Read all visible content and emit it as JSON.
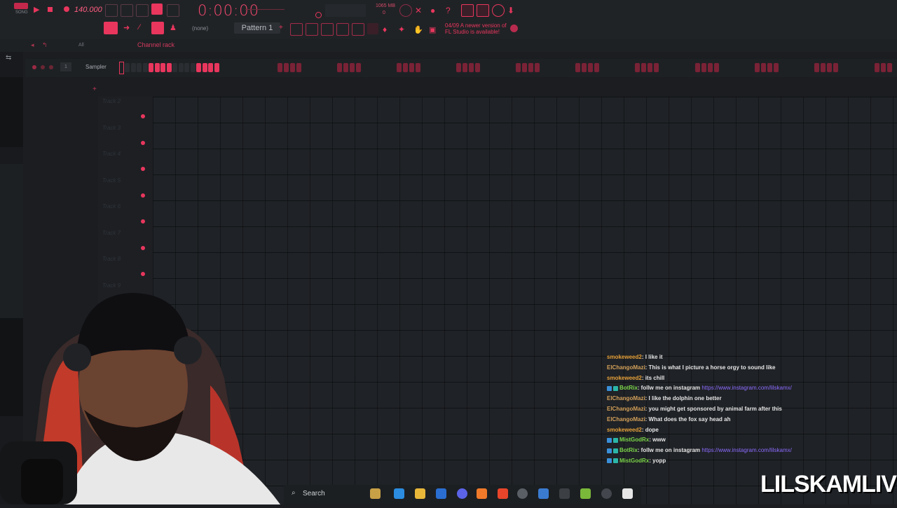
{
  "toolbar": {
    "tempo": "140.000",
    "time": "0:00:00",
    "memory": "1065 MB",
    "memory_sub": "0",
    "pattern": "Pattern 1",
    "none_label": "(none)",
    "news_line1": "04/09  A newer version of",
    "news_line2": "FL Studio is available!"
  },
  "channel_rack": {
    "title": "Channel rack",
    "filter": "All",
    "channel_number": "1",
    "channel_name": "Sampler"
  },
  "playlist": {
    "tracks": [
      "Track 2",
      "Track 3",
      "Track 4",
      "Track 5",
      "Track 6",
      "Track 7",
      "Track 8",
      "Track 9"
    ]
  },
  "chat": {
    "messages": [
      {
        "user": "smokeweed2",
        "text": ": I like it",
        "color": "#e8a23a",
        "badges": false,
        "link": ""
      },
      {
        "user": "ElChangoMazi",
        "text": ": This is what I picture a horse orgy to sound like",
        "color": "#d4a15a",
        "badges": false,
        "link": ""
      },
      {
        "user": "smokeweed2",
        "text": ": its chill",
        "color": "#e8a23a",
        "badges": false,
        "link": ""
      },
      {
        "user": "BotRix",
        "text": ": follw me on instagram ",
        "color": "#7cd64a",
        "badges": true,
        "link": "https://www.instagram.com/lilskamx/"
      },
      {
        "user": "ElChangoMazi",
        "text": ": I like the dolphin one better",
        "color": "#d4a15a",
        "badges": false,
        "link": ""
      },
      {
        "user": "ElChangoMazi",
        "text": ": you might get sponsored by animal farm after this",
        "color": "#d4a15a",
        "badges": false,
        "link": ""
      },
      {
        "user": "ElChangoMazi",
        "text": ": What does the fox say head ah",
        "color": "#d4a15a",
        "badges": false,
        "link": ""
      },
      {
        "user": "smokeweed2",
        "text": ": dope",
        "color": "#e8a23a",
        "badges": false,
        "link": ""
      },
      {
        "user": "MistGodRx",
        "text": ": www",
        "color": "#7cd64a",
        "badges": true,
        "link": ""
      },
      {
        "user": "BotRix",
        "text": ": follw me on instagram ",
        "color": "#7cd64a",
        "badges": true,
        "link": "https://www.instagram.com/lilskamx/"
      },
      {
        "user": "MistGodRx",
        "text": ": yopp",
        "color": "#7cd64a",
        "badges": true,
        "link": ""
      }
    ]
  },
  "taskbar": {
    "search_label": "Search"
  },
  "watermark": "LILSKAMLIVE",
  "colors": {
    "accent": "#e8365d",
    "background": "#1b1d20"
  }
}
